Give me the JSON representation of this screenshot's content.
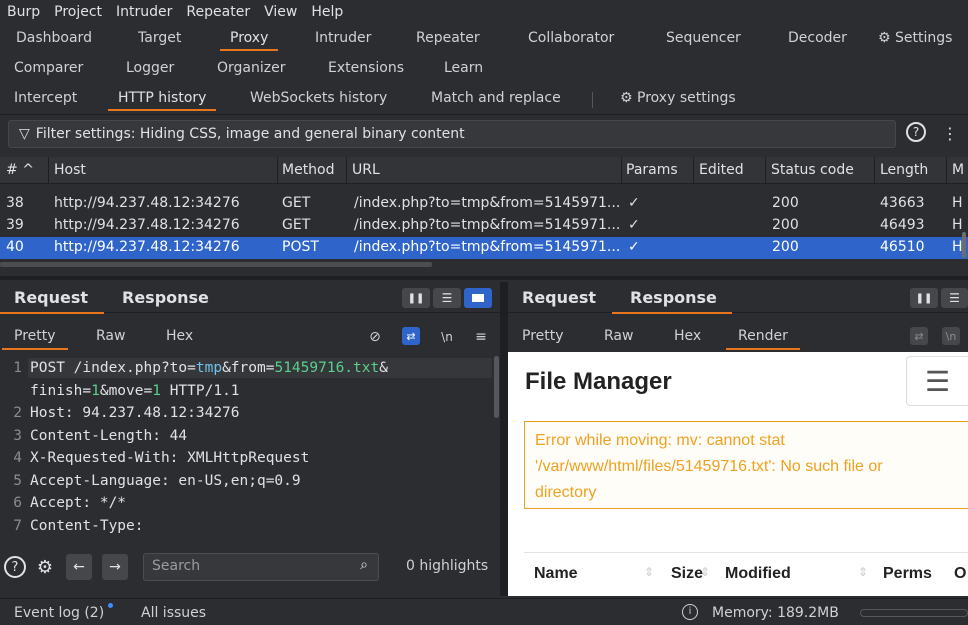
{
  "menubar": [
    "Burp",
    "Project",
    "Intruder",
    "Repeater",
    "View",
    "Help"
  ],
  "tabs_row1": [
    "Dashboard",
    "Target",
    "Proxy",
    "Intruder",
    "Repeater",
    "Collaborator",
    "Sequencer",
    "Decoder",
    "Settings"
  ],
  "tabs_row2": [
    "Comparer",
    "Logger",
    "Organizer",
    "Extensions",
    "Learn"
  ],
  "proxy_tabs": [
    "Intercept",
    "HTTP history",
    "WebSockets history",
    "Match and replace",
    "Proxy settings"
  ],
  "filter_text": "Filter settings: Hiding CSS, image and general binary content",
  "columns": [
    "#",
    "Host",
    "Method",
    "URL",
    "Params",
    "Edited",
    "Status code",
    "Length",
    "M"
  ],
  "rows": [
    {
      "num": "38",
      "host": "http://94.237.48.12:34276",
      "method": "GET",
      "url": "/index.php?to=tmp&from=5145971...",
      "params": "✓",
      "status": "200",
      "length": "43663",
      "mime": "H"
    },
    {
      "num": "39",
      "host": "http://94.237.48.12:34276",
      "method": "GET",
      "url": "/index.php?to=tmp&from=5145971...",
      "params": "✓",
      "status": "200",
      "length": "46493",
      "mime": "H"
    },
    {
      "num": "40",
      "host": "http://94.237.48.12:34276",
      "method": "POST",
      "url": "/index.php?to=tmp&from=5145971...",
      "params": "✓",
      "status": "200",
      "length": "46510",
      "mime": "H"
    }
  ],
  "left_pane": {
    "tabs": [
      "Request",
      "Response"
    ],
    "subtabs": [
      "Pretty",
      "Raw",
      "Hex"
    ],
    "newline_glyph": "\\n",
    "lines": [
      {
        "n": "1",
        "parts": [
          [
            "POST /index.php?to=",
            ""
          ],
          [
            "tmp",
            "hl"
          ],
          [
            "&from=",
            ""
          ],
          [
            "51459716.txt",
            "hg"
          ],
          [
            "&",
            ""
          ]
        ]
      },
      {
        "n": "",
        "parts": [
          [
            "finish=",
            ""
          ],
          [
            "1",
            "hg"
          ],
          [
            "&move=",
            ""
          ],
          [
            "1",
            "hg"
          ],
          [
            " HTTP/1.1",
            ""
          ]
        ]
      },
      {
        "n": "2",
        "parts": [
          [
            "Host: 94.237.48.12:34276",
            ""
          ]
        ]
      },
      {
        "n": "3",
        "parts": [
          [
            "Content-Length: 44",
            ""
          ]
        ]
      },
      {
        "n": "4",
        "parts": [
          [
            "X-Requested-With: XMLHttpRequest",
            ""
          ]
        ]
      },
      {
        "n": "5",
        "parts": [
          [
            "Accept-Language: en-US,en;q=0.9",
            ""
          ]
        ]
      },
      {
        "n": "6",
        "parts": [
          [
            "Accept: */*",
            ""
          ]
        ]
      },
      {
        "n": "7",
        "parts": [
          [
            "Content-Type:",
            ""
          ]
        ]
      }
    ],
    "search_placeholder": "Search",
    "highlights": "0 highlights"
  },
  "right_pane": {
    "tabs": [
      "Request",
      "Response"
    ],
    "subtabs": [
      "Pretty",
      "Raw",
      "Hex",
      "Render"
    ],
    "render_title": "File Manager",
    "error": "Error while moving: mv: cannot stat '/var/www/html/files/51459716.txt': No such file or directory",
    "table_cols": [
      "Name",
      "Size",
      "Modified",
      "Perms",
      "O"
    ]
  },
  "status": {
    "event_log": "Event log (2)",
    "all_issues": "All issues",
    "memory": "Memory: 189.2MB"
  }
}
